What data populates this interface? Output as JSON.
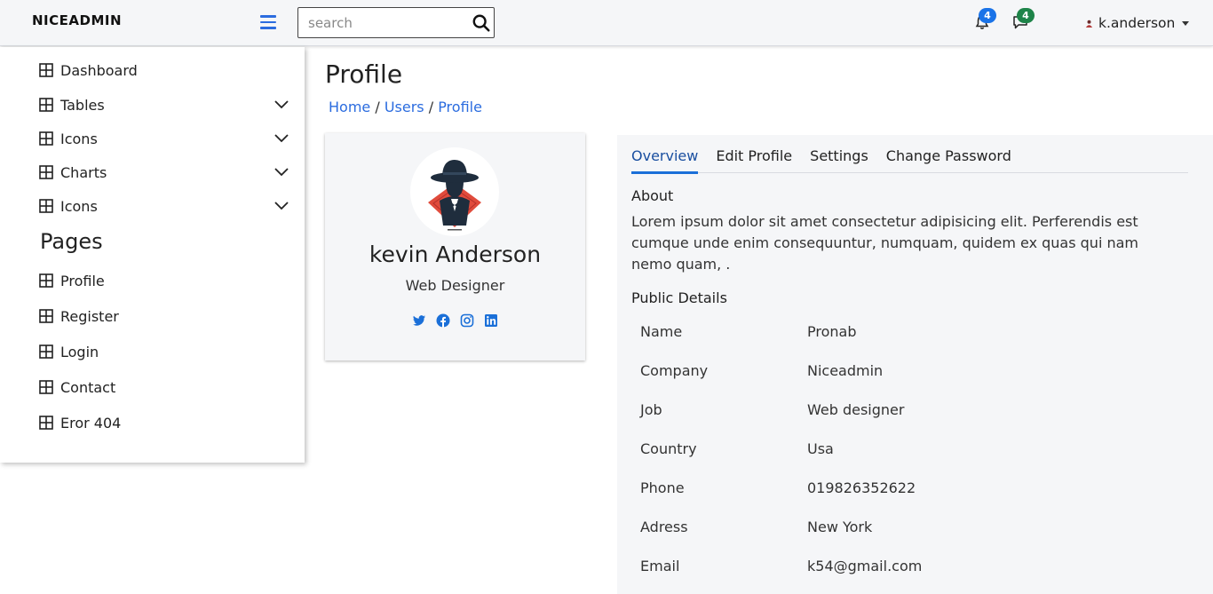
{
  "header": {
    "brand": "NICEADMIN",
    "search_placeholder": "search",
    "notifications_count": "4",
    "messages_count": "4",
    "username": "k.anderson"
  },
  "sidebar": {
    "items": [
      {
        "label": "Dashboard"
      },
      {
        "label": "Tables"
      },
      {
        "label": "Icons"
      },
      {
        "label": "Charts"
      },
      {
        "label": "Icons"
      }
    ],
    "pages_heading": "Pages",
    "pages": [
      {
        "label": "Profile"
      },
      {
        "label": "Register"
      },
      {
        "label": "Login"
      },
      {
        "label": "Contact"
      },
      {
        "label": "Eror 404"
      }
    ]
  },
  "main": {
    "title": "Profile",
    "breadcrumb": [
      "Home",
      "Users",
      "Profile"
    ],
    "breadcrumb_sep": " / "
  },
  "profile": {
    "name": "kevin Anderson",
    "role": "Web Designer",
    "socials": [
      "twitter-icon",
      "facebook-icon",
      "instagram-icon",
      "linkedin-icon"
    ]
  },
  "tabs": [
    "Overview",
    "Edit Profile",
    "Settings",
    "Change Password"
  ],
  "about": {
    "heading": "About",
    "text": "Lorem ipsum dolor sit amet consectetur adipisicing elit. Perferendis est cumque unde enim consequuntur, numquam, quidem ex quas qui nam nemo quam, ."
  },
  "public_details": {
    "heading": "Public Details",
    "rows": [
      {
        "label": "Name",
        "value": "Pronab"
      },
      {
        "label": "Company",
        "value": "Niceadmin"
      },
      {
        "label": "Job",
        "value": "Web designer"
      },
      {
        "label": "Country",
        "value": "Usa"
      },
      {
        "label": "Phone",
        "value": "019826352622"
      },
      {
        "label": "Adress",
        "value": "New York"
      },
      {
        "label": "Email",
        "value": "k54@gmail.com"
      }
    ]
  },
  "colors": {
    "accent": "#2b6cdf",
    "badge_blue": "#1a73e8",
    "badge_green": "#1e8449",
    "panel_bg": "#f5f6f8"
  }
}
